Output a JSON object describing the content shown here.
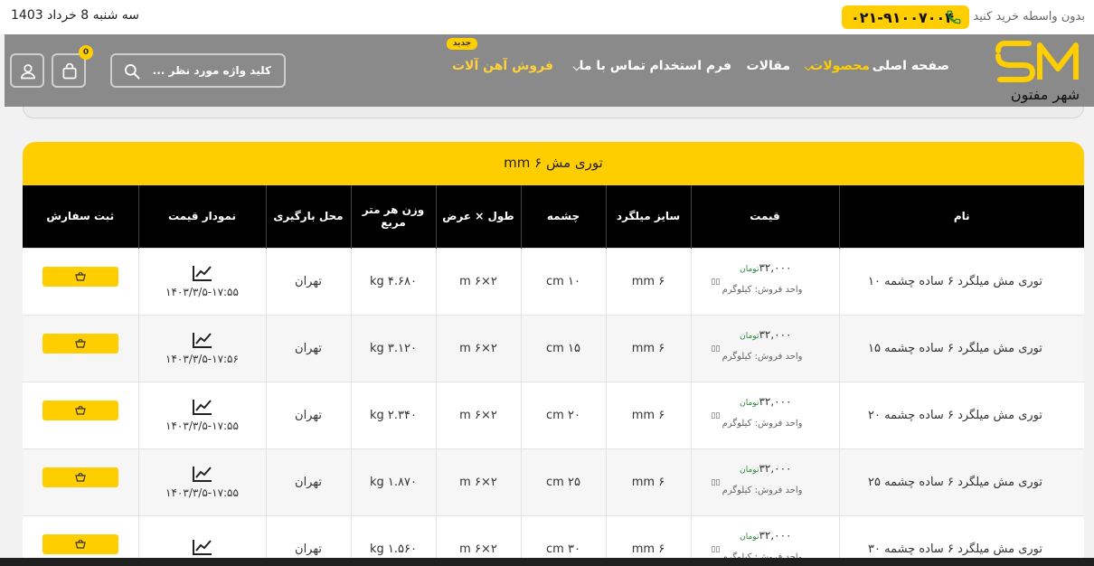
{
  "topbar": {
    "date": "سه شنبه 8 خرداد 1403",
    "buy_direct": "بدون واسطه خرید کنید",
    "phone": "۰۲۱-۹۱۰۰۷۰۰۴"
  },
  "nav": {
    "items": [
      {
        "label": "صفحه اصلی"
      },
      {
        "label": "محصولات"
      },
      {
        "label": "مقالات"
      },
      {
        "label": "فرم استخدام"
      },
      {
        "label": "تماس با ما"
      },
      {
        "label": "فروش آهن آلات"
      }
    ],
    "new_badge": "جدید",
    "search_placeholder": "کلید واژه مورد نظر ...",
    "cart_count": "0"
  },
  "table": {
    "title": "توری مش  ۶ mm",
    "headers": [
      "نام",
      "قیمت",
      "سایز میلگرد",
      "چشمه",
      "طول × عرض",
      "وزن هر متر مربع",
      "محل بارگیری",
      "نمودار قیمت",
      "ثبت سفارش"
    ],
    "rows": [
      {
        "name": "توری مش میلگرد ۶ ساده چشمه ۱۰",
        "price": "۳۲,۰۰۰",
        "currency": "تومان",
        "unit": "واحد فروش: کیلوگرم",
        "rebar": "۶ mm",
        "mesh": "۱۰ cm",
        "dims": "۲×۶ m",
        "weight": "۴.۶۸۰ kg",
        "location": "تهران",
        "updated": "۱۴۰۳/۳/۵-۱۷:۵۵"
      },
      {
        "name": "توری مش میلگرد ۶ ساده چشمه ۱۵",
        "price": "۳۲,۰۰۰",
        "currency": "تومان",
        "unit": "واحد فروش: کیلوگرم",
        "rebar": "۶ mm",
        "mesh": "۱۵ cm",
        "dims": "۲×۶ m",
        "weight": "۳.۱۲۰ kg",
        "location": "تهران",
        "updated": "۱۴۰۳/۳/۵-۱۷:۵۶"
      },
      {
        "name": "توری مش میلگرد ۶ ساده چشمه ۲۰",
        "price": "۳۲,۰۰۰",
        "currency": "تومان",
        "unit": "واحد فروش: کیلوگرم",
        "rebar": "۶ mm",
        "mesh": "۲۰ cm",
        "dims": "۲×۶ m",
        "weight": "۲.۳۴۰ kg",
        "location": "تهران",
        "updated": "۱۴۰۳/۳/۵-۱۷:۵۵"
      },
      {
        "name": "توری مش میلگرد ۶ ساده چشمه ۲۵",
        "price": "۳۲,۰۰۰",
        "currency": "تومان",
        "unit": "واحد فروش: کیلوگرم",
        "rebar": "۶ mm",
        "mesh": "۲۵ cm",
        "dims": "۲×۶ m",
        "weight": "۱.۸۷۰ kg",
        "location": "تهران",
        "updated": "۱۴۰۳/۳/۵-۱۷:۵۵"
      },
      {
        "name": "توری مش میلگرد ۶ ساده چشمه ۳۰",
        "price": "۳۲,۰۰۰",
        "currency": "تومان",
        "unit": "واحد فروش: کیلوگرم",
        "rebar": "۶ mm",
        "mesh": "۳۰ cm",
        "dims": "۲×۶ m",
        "weight": "۱.۵۶۰ kg",
        "location": "تهران",
        "updated": ""
      }
    ]
  },
  "colors": {
    "accent": "#ffce00",
    "nav_bg": "#8a8a8a",
    "header_bg": "#000000",
    "currency": "#2e8b3a"
  }
}
